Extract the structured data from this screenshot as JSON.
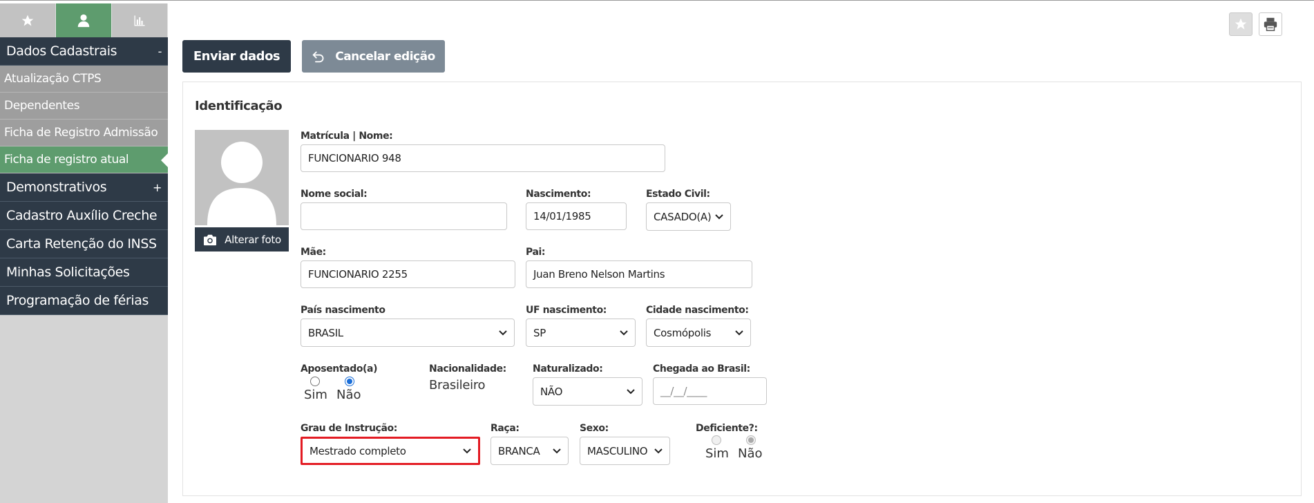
{
  "sidebar": {
    "tabs": [
      {
        "icon": "star-icon",
        "active": false
      },
      {
        "icon": "user-icon",
        "active": true
      },
      {
        "icon": "bar-chart-icon",
        "active": false
      }
    ],
    "sections": {
      "dados": {
        "label": "Dados Cadastrais",
        "toggle": "-"
      },
      "demonstrativos": {
        "label": "Demonstrativos",
        "toggle": "+"
      },
      "auxilio": {
        "label": "Cadastro Auxílio Creche"
      },
      "carta": {
        "label": "Carta Retenção do INSS"
      },
      "solicitacoes": {
        "label": "Minhas Solicitações"
      },
      "ferias": {
        "label": "Programação de férias"
      }
    },
    "subitems": [
      {
        "label": "Atualização CTPS"
      },
      {
        "label": "Dependentes"
      },
      {
        "label": "Ficha de Registro Admissão"
      },
      {
        "label": "Ficha de registro atual"
      }
    ]
  },
  "toolbar": {
    "send_label": "Enviar dados",
    "cancel_label": "Cancelar edição"
  },
  "panel": {
    "title": "Identificação",
    "photo_button": "Alterar foto"
  },
  "form": {
    "matricula": {
      "label": "Matrícula | Nome:",
      "value": "FUNCIONARIO 948"
    },
    "nome_social": {
      "label": "Nome social:",
      "value": ""
    },
    "nascimento": {
      "label": "Nascimento:",
      "value": "14/01/1985"
    },
    "estado_civil": {
      "label": "Estado Civil:",
      "value": "CASADO(A)"
    },
    "mae": {
      "label": "Mãe:",
      "value": "FUNCIONARIO 2255"
    },
    "pai": {
      "label": "Pai:",
      "value": "Juan Breno Nelson Martins"
    },
    "pais_nascimento": {
      "label": "País nascimento",
      "value": "BRASIL"
    },
    "uf_nascimento": {
      "label": "UF nascimento:",
      "value": "SP"
    },
    "cidade_nascimento": {
      "label": "Cidade nascimento:",
      "value": "Cosmópolis"
    },
    "aposentado": {
      "label": "Aposentado(a)",
      "yes": "Sim",
      "no": "Não",
      "selected": "Não"
    },
    "nacionalidade": {
      "label": "Nacionalidade:",
      "value": "Brasileiro"
    },
    "naturalizado": {
      "label": "Naturalizado:",
      "value": "NÃO"
    },
    "chegada": {
      "label": "Chegada ao Brasil:",
      "placeholder": "__/__/____"
    },
    "grau_instrucao": {
      "label": "Grau de Instrução:",
      "value": "Mestrado completo"
    },
    "raca": {
      "label": "Raça:",
      "value": "BRANCA"
    },
    "sexo": {
      "label": "Sexo:",
      "value": "MASCULINO"
    },
    "deficiente": {
      "label": "Deficiente?:",
      "yes": "Sim",
      "no": "Não",
      "selected": "Não"
    }
  },
  "colors": {
    "dark": "#2e3a47",
    "green": "#5e9c6e",
    "highlight": "#e31b23",
    "radio": "#1a6ed8"
  }
}
